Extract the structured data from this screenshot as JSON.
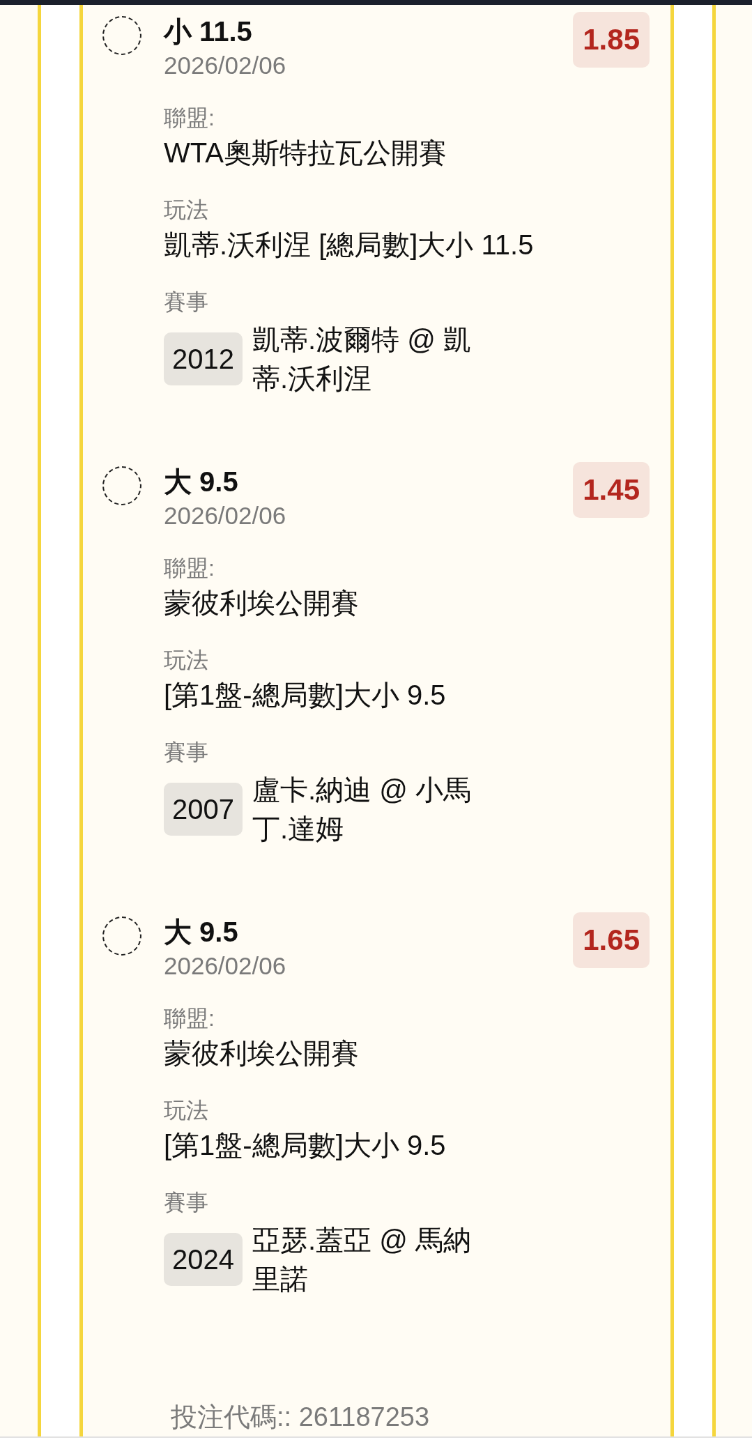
{
  "bets": [
    {
      "selected": false,
      "pick": "小 11.5",
      "date": "2026/02/06",
      "odds": "1.85",
      "league_label": "聯盟:",
      "league": "WTA奧斯特拉瓦公開賽",
      "play_label": "玩法",
      "play": "凱蒂.沃利涅 [總局數]大小 11.5",
      "match_label": "賽事",
      "match_code": "2012",
      "match": "凱蒂.波爾特 @ 凱蒂.沃利涅"
    },
    {
      "selected": false,
      "pick": "大 9.5",
      "date": "2026/02/06",
      "odds": "1.45",
      "league_label": "聯盟:",
      "league": "蒙彼利埃公開賽",
      "play_label": "玩法",
      "play": "[第1盤-總局數]大小 9.5",
      "match_label": "賽事",
      "match_code": "2007",
      "match": "盧卡.納迪 @ 小馬丁.達姆"
    },
    {
      "selected": false,
      "pick": "大 9.5",
      "date": "2026/02/06",
      "odds": "1.65",
      "league_label": "聯盟:",
      "league": "蒙彼利埃公開賽",
      "play_label": "玩法",
      "play": "[第1盤-總局數]大小 9.5",
      "match_label": "賽事",
      "match_code": "2024",
      "match": "亞瑟.蓋亞 @ 馬納里諾"
    }
  ],
  "footer": {
    "bet_code": "投注代碼:: 261187253"
  }
}
